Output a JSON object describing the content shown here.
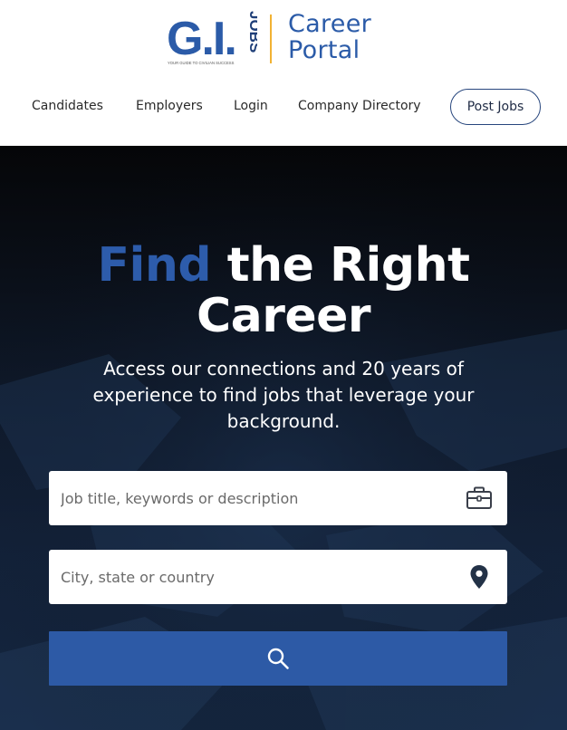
{
  "brand": {
    "logo_letters": "G.I.",
    "logo_jobs": "JOBS",
    "logo_tagline": "YOUR GUIDE TO CIVILIAN SUCCESS",
    "portal_line1": "Career",
    "portal_line2": "Portal",
    "colors": {
      "blue": "#2b5ba8",
      "gold": "#f2b233"
    }
  },
  "nav": {
    "items": [
      {
        "label": "Candidates"
      },
      {
        "label": "Employers"
      },
      {
        "label": "Login"
      },
      {
        "label": "Company Directory"
      }
    ],
    "post_jobs": "Post Jobs"
  },
  "hero": {
    "title_accent": "Find",
    "title_rest": "the Right",
    "title_line2": "Career",
    "subtitle": "Access our connections and 20 years of experience to find jobs that leverage your background.",
    "accent_color": "#2d5cab"
  },
  "search": {
    "keywords_placeholder": "Job title, keywords or description",
    "keywords_icon": "briefcase-icon",
    "location_placeholder": "City, state or country",
    "location_icon": "map-pin-icon",
    "button_icon": "search-icon",
    "button_color": "#2d5aa6"
  }
}
